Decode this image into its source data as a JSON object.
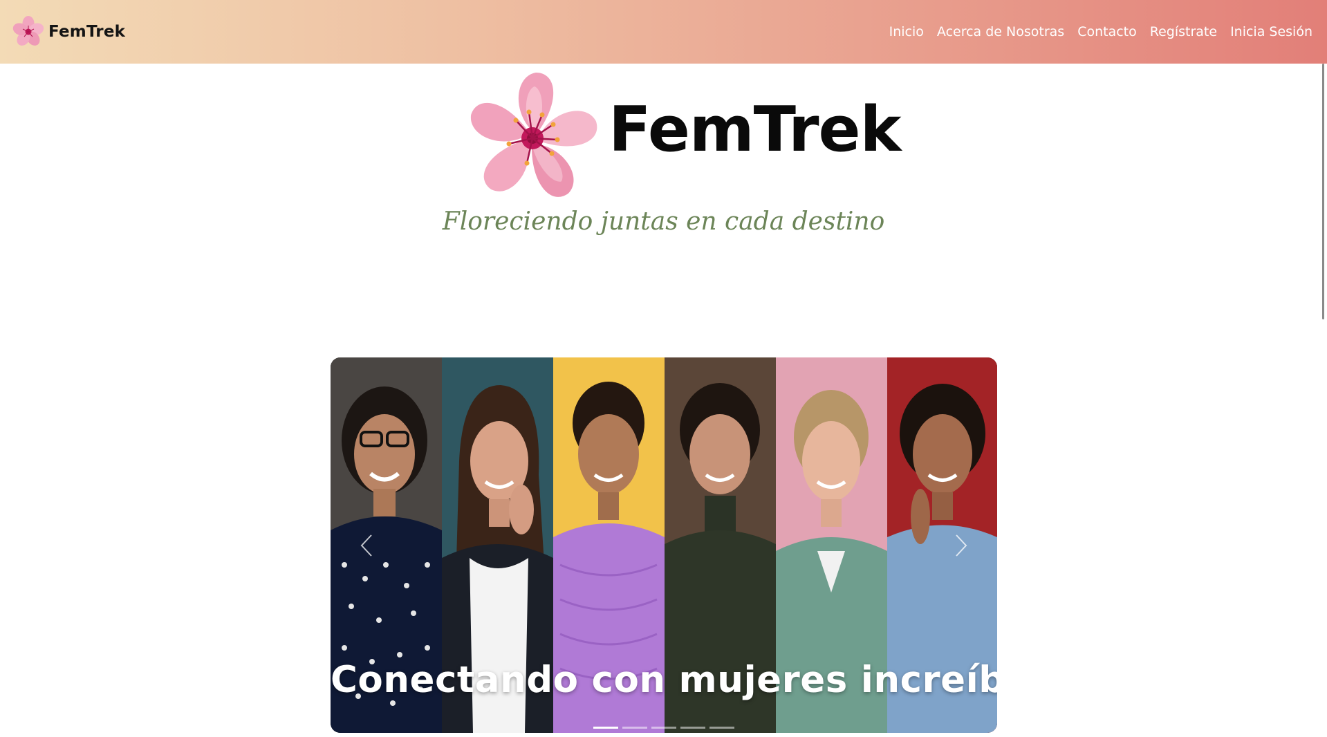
{
  "navbar": {
    "brand": "FemTrek",
    "links": [
      "Inicio",
      "Acerca de Nosotras",
      "Contacto",
      "Regístrate",
      "Inicia Sesión"
    ]
  },
  "hero": {
    "title": "FemTrek",
    "tagline": "Floreciendo juntas en cada destino"
  },
  "carousel": {
    "caption": "Conectando con mujeres increíbles",
    "slide_count": 5,
    "active_slide": 1
  },
  "colors": {
    "navbar_gradient_start": "#f3dbb6",
    "navbar_gradient_end": "#e27f78",
    "tagline": "#6c8558",
    "flower_pink": "#f0a3bd",
    "flower_center": "#c2185b"
  },
  "icons": {
    "brand_logo": "cherry-blossom-icon",
    "prev": "chevron-left-icon",
    "next": "chevron-right-icon"
  }
}
